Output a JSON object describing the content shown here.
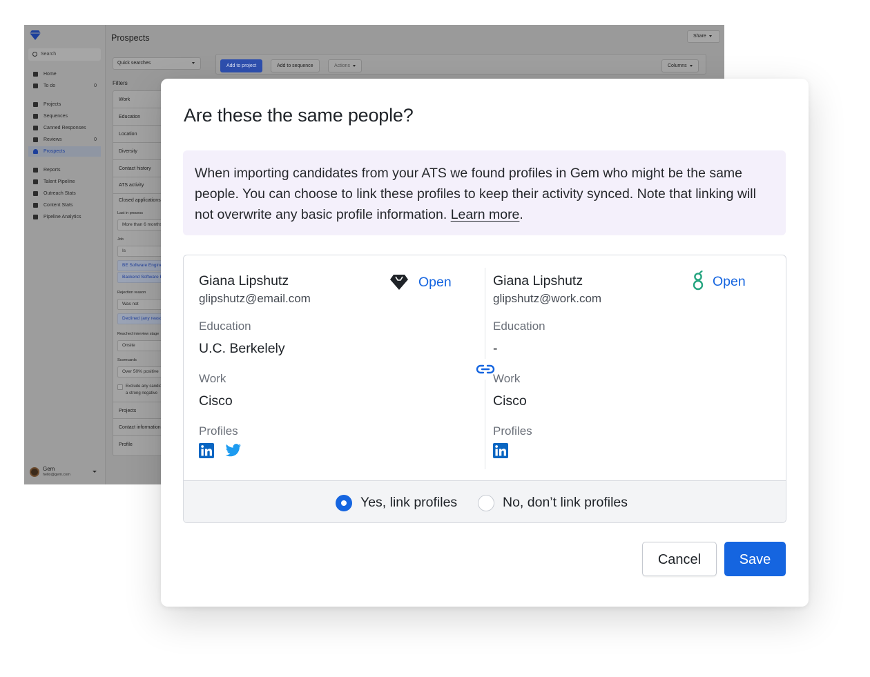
{
  "app": {
    "title": "Prospects",
    "share_label": "Share",
    "search_placeholder": "Search",
    "sidebar": {
      "items": [
        {
          "label": "Home",
          "icon": "home-icon",
          "count": ""
        },
        {
          "label": "To do",
          "icon": "checkbox-icon",
          "count": "0"
        },
        {
          "label": "Projects",
          "icon": "folder-icon",
          "count": ""
        },
        {
          "label": "Sequences",
          "icon": "sequence-icon",
          "count": ""
        },
        {
          "label": "Canned Responses",
          "icon": "inbox-icon",
          "count": ""
        },
        {
          "label": "Reviews",
          "icon": "review-icon",
          "count": "0"
        },
        {
          "label": "Prospects",
          "icon": "person-icon",
          "count": "",
          "active": true
        },
        {
          "label": "Reports",
          "icon": "report-icon",
          "count": ""
        },
        {
          "label": "Talent Pipeline",
          "icon": "filter-icon",
          "count": ""
        },
        {
          "label": "Outreach Stats",
          "icon": "stats-icon",
          "count": ""
        },
        {
          "label": "Content Stats",
          "icon": "content-icon",
          "count": ""
        },
        {
          "label": "Pipeline Analytics",
          "icon": "trend-icon",
          "count": ""
        }
      ],
      "user": {
        "name": "Gem",
        "email": "hello@gem.com"
      }
    },
    "quick_searches": "Quick searches",
    "toolbar": {
      "add_to_project": "Add to project",
      "add_to_sequence": "Add to sequence",
      "actions": "Actions",
      "columns": "Columns"
    },
    "filters": {
      "heading": "Filters",
      "sections": [
        "Work",
        "Education",
        "Location",
        "Diversity",
        "Contact history",
        "ATS activity"
      ],
      "closed_applications": "Closed applications",
      "last_in_process": "Last in process",
      "more_than": "More than 6 months",
      "job": "Job",
      "is": "Is",
      "job_values": [
        "BE Software Engineer",
        "Backend Software Engineer"
      ],
      "rejection_reason": "Rejection reason",
      "was_not": "Was not",
      "declined": "Declined (any reason)",
      "reached_interview": "Reached interview stage",
      "onsite": "Onsite",
      "scorecards": "Scorecards",
      "over_50": "Over 50% positive",
      "exclude_line1": "Exclude any candidates with",
      "exclude_line2": "a strong negative",
      "bottom_sections": [
        "Projects",
        "Contact information",
        "Profile"
      ]
    }
  },
  "modal": {
    "title": "Are these the same people?",
    "notice_text": "When importing candidates from your ATS we found profiles in Gem who might be the same people. You can choose to link these profiles to keep their activity synced. Note that linking will not overwrite any basic profile information.",
    "learn_more": "Learn more",
    "notice_end": ".",
    "left": {
      "name": "Giana Lipshutz",
      "email": "glipshutz@email.com",
      "open_label": "Open",
      "source_icon": "gem-logo-icon",
      "education_label": "Education",
      "education_value": "U.C. Berkelely",
      "work_label": "Work",
      "work_value": "Cisco",
      "profiles_label": "Profiles",
      "profiles": [
        "linkedin-icon",
        "twitter-icon"
      ]
    },
    "right": {
      "name": "Giana Lipshutz",
      "email": "glipshutz@work.com",
      "open_label": "Open",
      "source_icon": "greenhouse-logo-icon",
      "education_label": "Education",
      "education_value": "-",
      "work_label": "Work",
      "work_value": "Cisco",
      "profiles_label": "Profiles",
      "profiles": [
        "linkedin-icon"
      ]
    },
    "link_options": {
      "yes_label": "Yes, link profiles",
      "no_label": "No, don’t link profiles",
      "selected": "yes"
    },
    "cancel_label": "Cancel",
    "save_label": "Save",
    "colors": {
      "accent": "#1565e0",
      "notice_bg": "#f4f0fb",
      "greenhouse": "#24a47f",
      "linkedin": "#0a66c2",
      "twitter": "#1d9bf0"
    }
  }
}
